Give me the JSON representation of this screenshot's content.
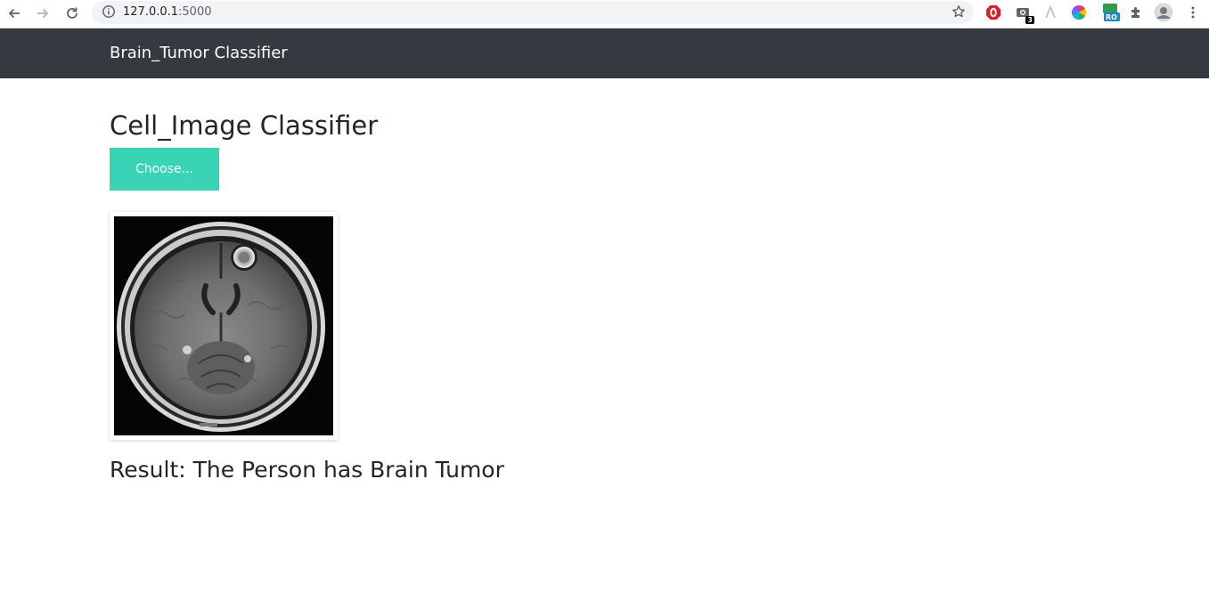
{
  "browser": {
    "url_host": "127.0.0.1",
    "url_port": ":5000",
    "extension_badge": "3",
    "extension_ro_label": "RO"
  },
  "navbar": {
    "brand": "Brain_Tumor Classifier",
    "background": "#343a40"
  },
  "main": {
    "title": "Cell_Image Classifier",
    "choose_label": "Choose...",
    "choose_color": "#39d3b6",
    "preview_image": "brain-mri-scan",
    "result": "Result: The Person has Brain Tumor"
  }
}
